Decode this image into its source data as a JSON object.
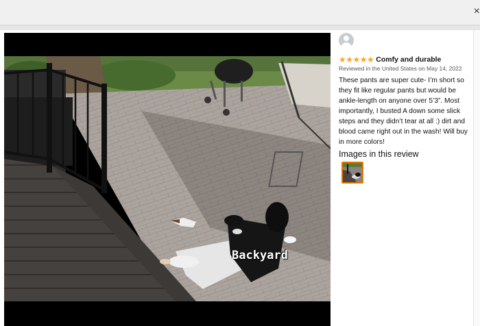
{
  "window": {
    "close_glyph": "×"
  },
  "video": {
    "watermark": "Backyard"
  },
  "review": {
    "avatar_icon": "user-avatar-icon",
    "stars": "★★★★★",
    "rating": 5,
    "title": "Comfy and durable",
    "meta": "Reviewed in the United States on May 14, 2022",
    "body": "These pants are super cute- I’m short so they fit like regular pants but would be ankle-length on anyone over 5’3”. Most importantly, I busted A down some slick steps and they didn’t tear at all :) dirt and blood came right out in the wash! Will buy in more colors!",
    "images_heading": "Images in this review"
  },
  "colors": {
    "star": "#ffa41c",
    "thumb_border": "#e77600"
  }
}
